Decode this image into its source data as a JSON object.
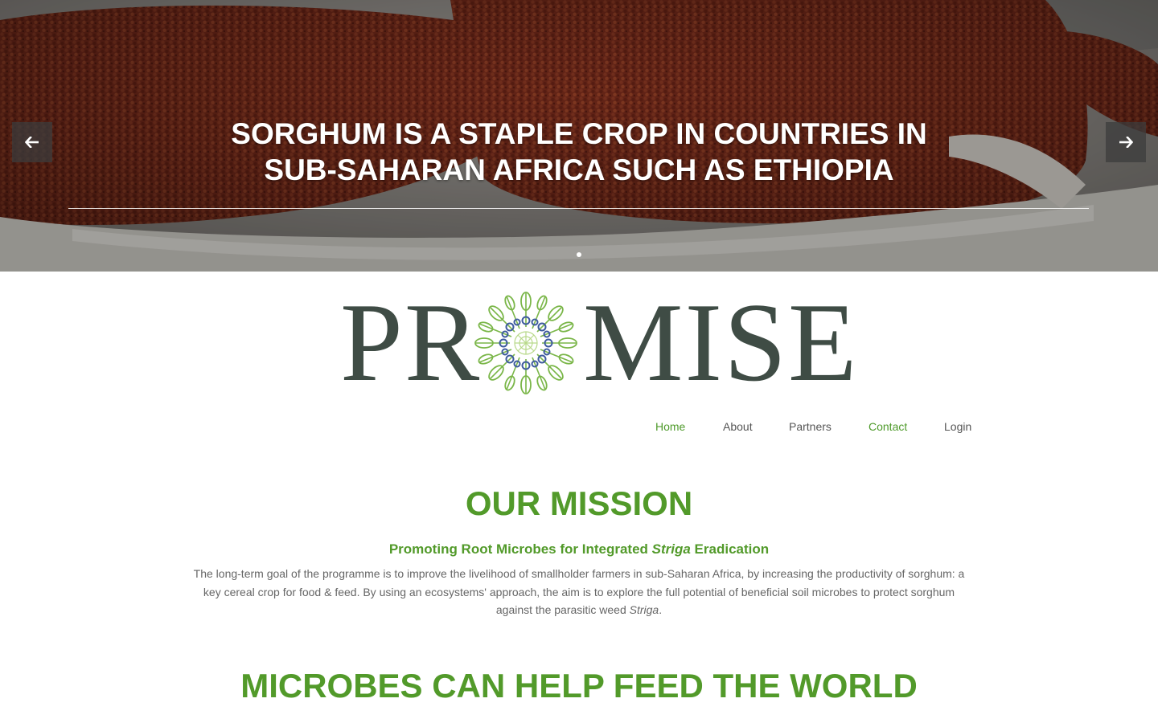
{
  "hero": {
    "title": "SORGHUM IS A STAPLE CROP IN COUNTRIES IN SUB-SAHARAN AFRICA SUCH AS ETHIOPIA",
    "prev_icon": "arrow-left-icon",
    "next_icon": "arrow-right-icon",
    "slide_count": 1,
    "active_slide": 1
  },
  "logo": {
    "text_left": "PR",
    "text_right": "MISE",
    "emblem": "flower-emblem-icon",
    "colors": {
      "text": "#3f4c45",
      "green": "#7ab648",
      "blue": "#3d5a9e"
    }
  },
  "nav": {
    "items": [
      {
        "label": "Home",
        "state": "active"
      },
      {
        "label": "About",
        "state": "normal"
      },
      {
        "label": "Partners",
        "state": "normal"
      },
      {
        "label": "Contact",
        "state": "highlighted"
      },
      {
        "label": "Login",
        "state": "normal"
      }
    ]
  },
  "mission": {
    "title": "OUR MISSION",
    "subtitle_pre": "Promoting Root Microbes for Integrated ",
    "subtitle_em": "Striga",
    "subtitle_post": " Eradication",
    "body_pre": "The long-term goal of the programme is to improve the livelihood of smallholder farmers in sub-Saharan Africa, by increasing the productivity of sorghum: a key cereal crop for food & feed. By using an ecosystems' approach, the aim is to explore the full potential of beneficial soil microbes to protect sorghum against the parasitic weed ",
    "body_em": "Striga",
    "body_post": "."
  },
  "world": {
    "title": "MICROBES CAN HELP FEED THE WORLD"
  },
  "colors": {
    "accent_green": "#529a2a",
    "nav_text": "#555555",
    "body_text": "#666666"
  }
}
